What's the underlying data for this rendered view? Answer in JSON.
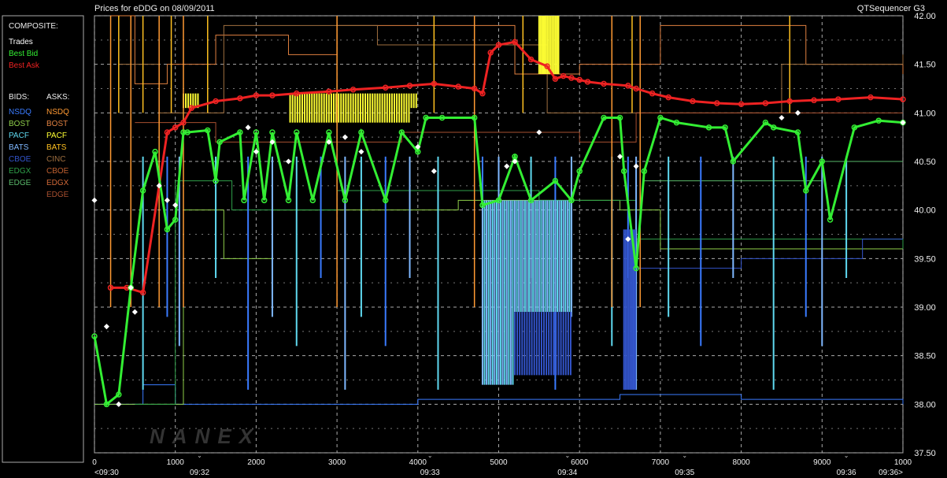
{
  "header": {
    "title": "Prices for  eDDG  on  08/09/2011",
    "app_name": "QTSequencer G3"
  },
  "legend": {
    "composite_title": "COMPOSITE:",
    "composite_items": [
      {
        "label": "Trades",
        "color": "#ffffff"
      },
      {
        "label": "Best Bid",
        "color": "#33ee33"
      },
      {
        "label": "Best Ask",
        "color": "#ee2222"
      }
    ],
    "bids_title": "BIDS:",
    "asks_title": "ASKS:",
    "bids": [
      {
        "label": "NSDQ",
        "color": "#3a7bff"
      },
      {
        "label": "BOST",
        "color": "#8fcf4a"
      },
      {
        "label": "PACF",
        "color": "#5fd9f0"
      },
      {
        "label": "BATS",
        "color": "#7fb8ff"
      },
      {
        "label": "CBOE",
        "color": "#3355cc"
      },
      {
        "label": "EDGX",
        "color": "#2fa04a"
      },
      {
        "label": "EDGE",
        "color": "#59b86a"
      }
    ],
    "asks": [
      {
        "label": "NSDQ",
        "color": "#ff9a33"
      },
      {
        "label": "BOST",
        "color": "#e08040"
      },
      {
        "label": "PACF",
        "color": "#ffff33"
      },
      {
        "label": "BATS",
        "color": "#ffc020"
      },
      {
        "label": "CINC",
        "color": "#a07040"
      },
      {
        "label": "CBOE",
        "color": "#c06030"
      },
      {
        "label": "EDGX",
        "color": "#d06838"
      },
      {
        "label": "EDGE",
        "color": "#a85030"
      }
    ]
  },
  "watermark": "NANEX",
  "chart_data": {
    "type": "line",
    "title": "Prices for  eDDG  on  08/09/2011",
    "xlim": [
      0,
      10000
    ],
    "ylim": [
      37.5,
      42.0
    ],
    "x_ticks": [
      "0",
      "1000",
      "2000",
      "3000",
      "4000",
      "5000",
      "6000",
      "7000",
      "8000",
      "9000",
      "1000"
    ],
    "x_tick_values": [
      0,
      1000,
      2000,
      3000,
      4000,
      5000,
      6000,
      7000,
      8000,
      9000,
      10000
    ],
    "time_labels": [
      "<09:30",
      "09:32",
      "09:33",
      "09:34",
      "09:35",
      "09:36",
      "09:36>"
    ],
    "time_label_values": [
      0,
      1300,
      4150,
      5850,
      7300,
      9300,
      10000
    ],
    "y_ticks": [
      "37.50",
      "38.00",
      "38.50",
      "39.00",
      "39.50",
      "40.00",
      "40.50",
      "41.00",
      "41.50",
      "42.00"
    ],
    "y_tick_values": [
      37.5,
      38.0,
      38.5,
      39.0,
      39.5,
      40.0,
      40.5,
      41.0,
      41.5,
      42.0
    ],
    "grid": true,
    "series": [
      {
        "name": "Best Ask",
        "color": "#ee2222",
        "x": [
          200,
          400,
          600,
          900,
          1000,
          1100,
          1200,
          1500,
          1800,
          2000,
          2200,
          2500,
          2900,
          3200,
          3600,
          3900,
          4200,
          4500,
          4700,
          4800,
          4900,
          5000,
          5200,
          5400,
          5600,
          5700,
          5800,
          5900,
          6000,
          6100,
          6300,
          6600,
          6700,
          6900,
          7100,
          7400,
          7700,
          8000,
          8300,
          8600,
          8900,
          9200,
          9600,
          10000
        ],
        "y": [
          39.2,
          39.2,
          39.15,
          40.8,
          40.85,
          40.9,
          41.05,
          41.12,
          41.15,
          41.18,
          41.18,
          41.2,
          41.22,
          41.24,
          41.26,
          41.28,
          41.3,
          41.27,
          41.25,
          41.2,
          41.62,
          41.7,
          41.73,
          41.55,
          41.48,
          41.35,
          41.38,
          41.36,
          41.34,
          41.32,
          41.3,
          41.28,
          41.25,
          41.2,
          41.16,
          41.12,
          41.1,
          41.09,
          41.1,
          41.12,
          41.13,
          41.14,
          41.16,
          41.14
        ]
      },
      {
        "name": "Best Bid",
        "color": "#33ee33",
        "x": [
          0,
          150,
          300,
          450,
          600,
          750,
          900,
          1000,
          1100,
          1150,
          1400,
          1500,
          1550,
          1800,
          1850,
          2000,
          2100,
          2200,
          2400,
          2500,
          2700,
          2900,
          3100,
          3300,
          3600,
          3800,
          4000,
          4100,
          4300,
          4700,
          4800,
          5000,
          5200,
          5400,
          5700,
          5900,
          6000,
          6300,
          6500,
          6550,
          6700,
          6800,
          7000,
          7200,
          7600,
          7800,
          7900,
          8300,
          8400,
          8700,
          8800,
          9000,
          9100,
          9400,
          9700,
          10000
        ],
        "y": [
          38.7,
          38.0,
          38.1,
          39.2,
          40.2,
          40.6,
          39.8,
          39.9,
          40.8,
          40.8,
          40.82,
          40.3,
          40.7,
          40.8,
          40.1,
          40.8,
          40.1,
          40.8,
          40.1,
          40.8,
          40.1,
          40.8,
          40.1,
          40.8,
          40.1,
          40.8,
          40.6,
          40.95,
          40.95,
          40.95,
          40.05,
          40.1,
          40.55,
          40.1,
          40.3,
          40.1,
          40.4,
          40.95,
          40.95,
          40.4,
          39.4,
          40.4,
          40.95,
          40.9,
          40.85,
          40.85,
          40.5,
          40.9,
          40.85,
          40.8,
          40.2,
          40.5,
          39.9,
          40.85,
          40.92,
          40.9
        ]
      },
      {
        "name": "Trades",
        "color": "#ffffff",
        "type": "scatter",
        "x": [
          0,
          150,
          300,
          450,
          500,
          800,
          900,
          1000,
          1900,
          2000,
          2200,
          2400,
          2900,
          3100,
          3300,
          4000,
          4200,
          5100,
          5200,
          5500,
          6500,
          6600,
          6700,
          8500,
          8700,
          10000
        ],
        "y": [
          40.1,
          38.8,
          38.0,
          39.2,
          38.95,
          40.25,
          40.1,
          40.05,
          40.85,
          40.6,
          40.7,
          40.5,
          40.7,
          40.75,
          40.6,
          40.65,
          40.4,
          40.45,
          40.5,
          40.8,
          40.55,
          39.7,
          40.45,
          40.95,
          41.0,
          40.9
        ]
      }
    ]
  }
}
